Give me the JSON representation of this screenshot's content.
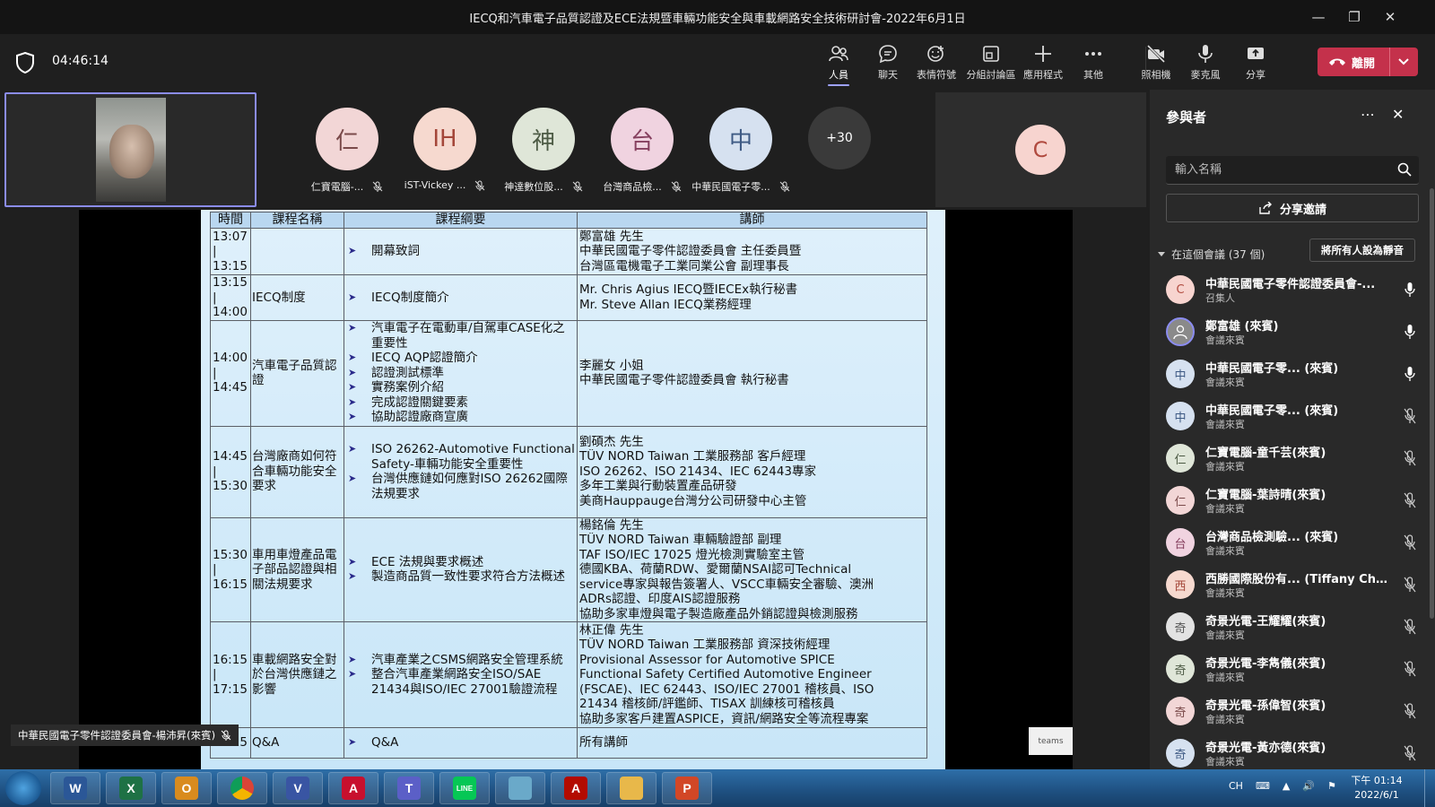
{
  "window": {
    "title": "IECQ和汽車電子品質認證及ECE法規暨車輛功能安全與車載網路安全技術研討會-2022年6月1日"
  },
  "toolbar": {
    "timer": "04:46:14",
    "buttons": [
      {
        "id": "people",
        "label": "人員",
        "icon": "people-icon"
      },
      {
        "id": "chat",
        "label": "聊天",
        "icon": "chat-icon"
      },
      {
        "id": "react",
        "label": "表情符號",
        "icon": "reaction-icon"
      },
      {
        "id": "rooms",
        "label": "分組討論區",
        "icon": "breakout-rooms-icon"
      },
      {
        "id": "apps",
        "label": "應用程式",
        "icon": "plus-icon"
      },
      {
        "id": "more",
        "label": "其他",
        "icon": "more-icon"
      },
      {
        "id": "camera",
        "label": "照相機",
        "icon": "camera-off-icon"
      },
      {
        "id": "mic",
        "label": "麥克風",
        "icon": "microphone-icon"
      },
      {
        "id": "share",
        "label": "分享",
        "icon": "share-screen-icon"
      }
    ],
    "leave_label": "離開"
  },
  "gallery": {
    "participants": [
      {
        "initial": "仁",
        "name": "仁寶電腦-...",
        "color": "#f2d6d6",
        "text": "#7a4a4a"
      },
      {
        "initial": "IH",
        "name": "iST-Vickey ...",
        "color": "#f6d9cf",
        "text": "#a4473a"
      },
      {
        "initial": "神",
        "name": "神達數位股...",
        "color": "#dfe6d8",
        "text": "#4c5a44"
      },
      {
        "initial": "台",
        "name": "台灣商品檢...",
        "color": "#f0d3e0",
        "text": "#86405f"
      },
      {
        "initial": "中",
        "name": "中華民國電子零...",
        "color": "#d6e1f0",
        "text": "#3e5a84"
      }
    ],
    "overflow": "+30",
    "right_tile_initial": "C"
  },
  "presenter_caption": "中華民國電子零件認證委員會-楊沛昇(來賓)",
  "teams_badge": "teams",
  "slide": {
    "headers": [
      "時間",
      "課程名稱",
      "課程綱要",
      "講師"
    ],
    "rows": [
      {
        "time": "13:07\n|\n13:15",
        "course": "",
        "outline": [
          "開幕致詞"
        ],
        "lecturer": [
          "鄭富雄 先生",
          "中華民國電子零件認證委員會 主任委員暨",
          "台灣區電機電子工業同業公會 副理事長"
        ]
      },
      {
        "time": "13:15\n|\n14:00",
        "course": "IECQ制度",
        "outline": [
          "IECQ制度簡介"
        ],
        "lecturer": [
          "Mr. Chris Agius IECQ暨IECEx執行秘書",
          "Mr. Steve Allan IECQ業務經理"
        ]
      },
      {
        "time": "14:00\n|\n14:45",
        "course": "汽車電子品質認證",
        "outline": [
          "汽車電子在電動車/自駕車CASE化之重要性",
          "IECQ AQP認證簡介",
          "認證測試標準",
          "實務案例介紹",
          "完成認證關鍵要素",
          "協助認證廠商宣廣"
        ],
        "lecturer": [
          "李麗女 小姐",
          "中華民國電子零件認證委員會 執行秘書"
        ]
      },
      {
        "time": "14:45\n|\n15:30",
        "course": "台灣廠商如何符合車輛功能安全要求",
        "outline": [
          "ISO 26262-Automotive Functional Safety-車輛功能安全重要性",
          "台灣供應鏈如何應對ISO 26262國際法規要求"
        ],
        "lecturer": [
          "劉碩杰 先生",
          "TÜV NORD Taiwan 工業服務部 客戶經理",
          "ISO 26262、ISO 21434、IEC 62443專家",
          "多年工業與行動裝置產品研發",
          "美商Hauppauge台灣分公司研發中心主管"
        ]
      },
      {
        "time": "15:30\n|\n16:15",
        "course": "車用車燈產品電子部品認證與相關法規要求",
        "outline": [
          "ECE 法規與要求概述",
          "製造商品質一致性要求符合方法概述"
        ],
        "lecturer": [
          "楊銘倫 先生",
          "TÜV NORD Taiwan 車輛驗證部 副理",
          "TAF ISO/IEC 17025 燈光檢測實驗室主管",
          "德國KBA、荷蘭RDW、愛爾蘭NSAI認可Technical",
          "service專家與報告簽署人、VSCC車輛安全審驗、澳洲",
          "ADRs認證、印度AIS認證服務",
          "協助多家車燈與電子製造廠產品外銷認證與檢測服務"
        ]
      },
      {
        "time": "16:15\n|\n17:15",
        "course": "車載網路安全對於台灣供應鏈之影響",
        "outline": [
          "汽車產業之CSMS網路安全管理系統",
          "整合汽車產業網路安全ISO/SAE 21434與ISO/IEC 27001驗證流程"
        ],
        "lecturer": [
          "林正偉 先生",
          "TÜV NORD Taiwan 工業服務部 資深技術經理",
          "Provisional Assessor for Automotive SPICE",
          "Functional Safety Certified Automotive Engineer",
          "(FSCAE)、IEC 62443、ISO/IEC 27001 稽核員、ISO",
          "21434 稽核師/評鑑師、TISAX 訓練核可稽核員",
          "協助多家客戶建置ASPICE，資訊/網路安全等流程專案"
        ]
      },
      {
        "time": "17:15",
        "course": "Q&A",
        "outline": [
          "Q&A"
        ],
        "lecturer": [
          "所有講師"
        ]
      }
    ]
  },
  "panel": {
    "title": "參與者",
    "search_placeholder": "輸入名稱",
    "invite_label": "分享邀請",
    "section_label": "在這個會議 (37 個)",
    "mute_all_label": "將所有人設為靜音",
    "people": [
      {
        "initial": "C",
        "name": "中華民國電子零件認證委員會-...",
        "role": "召集人",
        "mic": "on",
        "bg": "#f7d4cf",
        "fg": "#b04a3f"
      },
      {
        "initial": "",
        "name": "鄭富雄 (來賓)",
        "role": "會議來賓",
        "mic": "on",
        "bg": "#8a8a8a",
        "fg": "#fff"
      },
      {
        "initial": "中",
        "name": "中華民國電子零... (來賓)",
        "role": "會議來賓",
        "mic": "on",
        "bg": "#d6e1f0",
        "fg": "#3e5a84"
      },
      {
        "initial": "中",
        "name": "中華民國電子零... (來賓)",
        "role": "會議來賓",
        "mic": "off",
        "bg": "#d6e1f0",
        "fg": "#3e5a84"
      },
      {
        "initial": "仁",
        "name": "仁寶電腦-童千芸(來賓)",
        "role": "會議來賓",
        "mic": "off",
        "bg": "#dfe6d8",
        "fg": "#4c5a44"
      },
      {
        "initial": "仁",
        "name": "仁寶電腦-葉詩晴(來賓)",
        "role": "會議來賓",
        "mic": "off",
        "bg": "#f2d6d6",
        "fg": "#7a4a4a"
      },
      {
        "initial": "台",
        "name": "台灣商品檢測驗... (來賓)",
        "role": "會議來賓",
        "mic": "off",
        "bg": "#f0d3e0",
        "fg": "#86405f"
      },
      {
        "initial": "西",
        "name": "西勝國際股份有... (Tiffany Chen...",
        "role": "會議來賓",
        "mic": "off",
        "bg": "#f6d9cf",
        "fg": "#a4473a"
      },
      {
        "initial": "奇",
        "name": "奇景光電-王耀耀(來賓)",
        "role": "會議來賓",
        "mic": "off",
        "bg": "#e2e2e2",
        "fg": "#555"
      },
      {
        "initial": "奇",
        "name": "奇景光電-李雋儀(來賓)",
        "role": "會議來賓",
        "mic": "off",
        "bg": "#dfe6d8",
        "fg": "#4c5a44"
      },
      {
        "initial": "奇",
        "name": "奇景光電-孫偉智(來賓)",
        "role": "會議來賓",
        "mic": "off",
        "bg": "#f2d6d6",
        "fg": "#7a4a4a"
      },
      {
        "initial": "奇",
        "name": "奇景光電-黃亦德(來賓)",
        "role": "會議來賓",
        "mic": "off",
        "bg": "#d6e1f0",
        "fg": "#3e5a84"
      }
    ]
  },
  "taskbar": {
    "apps": [
      {
        "name": "word",
        "letter": "W",
        "color": "#2b5797"
      },
      {
        "name": "excel",
        "letter": "X",
        "color": "#1e7145"
      },
      {
        "name": "outlook",
        "letter": "O",
        "color": "#d98b1e"
      },
      {
        "name": "chrome",
        "letter": "",
        "color": "#db4437"
      },
      {
        "name": "visio",
        "letter": "V",
        "color": "#3955a3"
      },
      {
        "name": "acrobat",
        "letter": "A",
        "color": "#c8102e"
      },
      {
        "name": "teams",
        "letter": "T",
        "color": "#5b5fc7"
      },
      {
        "name": "line",
        "letter": "LINE",
        "color": "#06c755"
      },
      {
        "name": "notes",
        "letter": "",
        "color": "#6aa9c9"
      },
      {
        "name": "reader",
        "letter": "A",
        "color": "#b30b00"
      },
      {
        "name": "explorer",
        "letter": "",
        "color": "#e8b84a"
      },
      {
        "name": "powerpoint",
        "letter": "P",
        "color": "#d24726"
      }
    ],
    "lang": "CH",
    "time": "下午 01:14",
    "date": "2022/6/1"
  }
}
